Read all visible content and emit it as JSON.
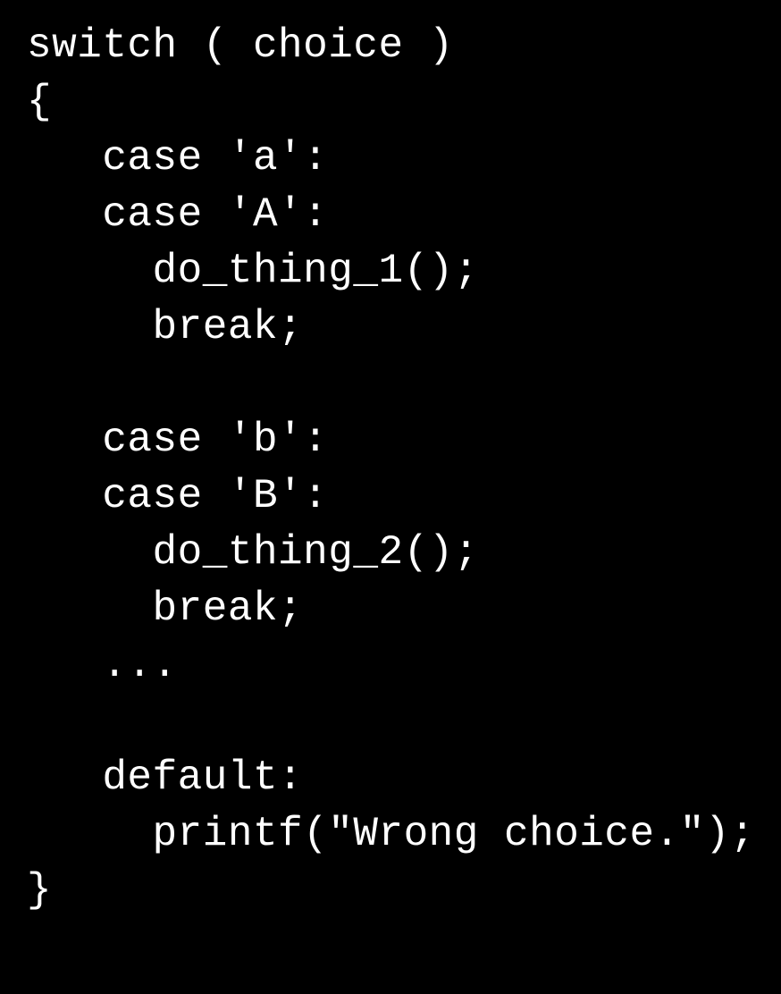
{
  "code": {
    "lines": [
      "switch ( choice )",
      "{",
      "   case 'a':",
      "   case 'A':",
      "     do_thing_1();",
      "     break;",
      "",
      "   case 'b':",
      "   case 'B':",
      "     do_thing_2();",
      "     break;",
      "   ...",
      "",
      "   default:",
      "     printf(\"Wrong choice.\");",
      "}"
    ]
  }
}
